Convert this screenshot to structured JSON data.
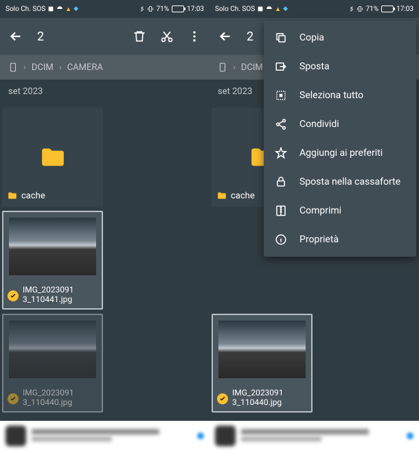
{
  "status": {
    "carrier": "Solo Ch. SOS",
    "battery_pct": "71%",
    "time": "17:03"
  },
  "topbar": {
    "selection_count": "2"
  },
  "breadcrumb": {
    "root": "DCIM",
    "current": "CAMERA"
  },
  "section": "set 2023",
  "items": {
    "folder_name": "cache",
    "img1": "IMG_2023091\n3_110441.jpg",
    "img2": "IMG_2023091\n3_110440.jpg"
  },
  "menu": {
    "copy": "Copia",
    "move": "Sposta",
    "select_all": "Seleziona tutto",
    "share": "Condividi",
    "favorite": "Aggiungi ai preferiti",
    "safe": "Sposta nella cassaforte",
    "compress": "Comprimi",
    "props": "Proprietà"
  }
}
